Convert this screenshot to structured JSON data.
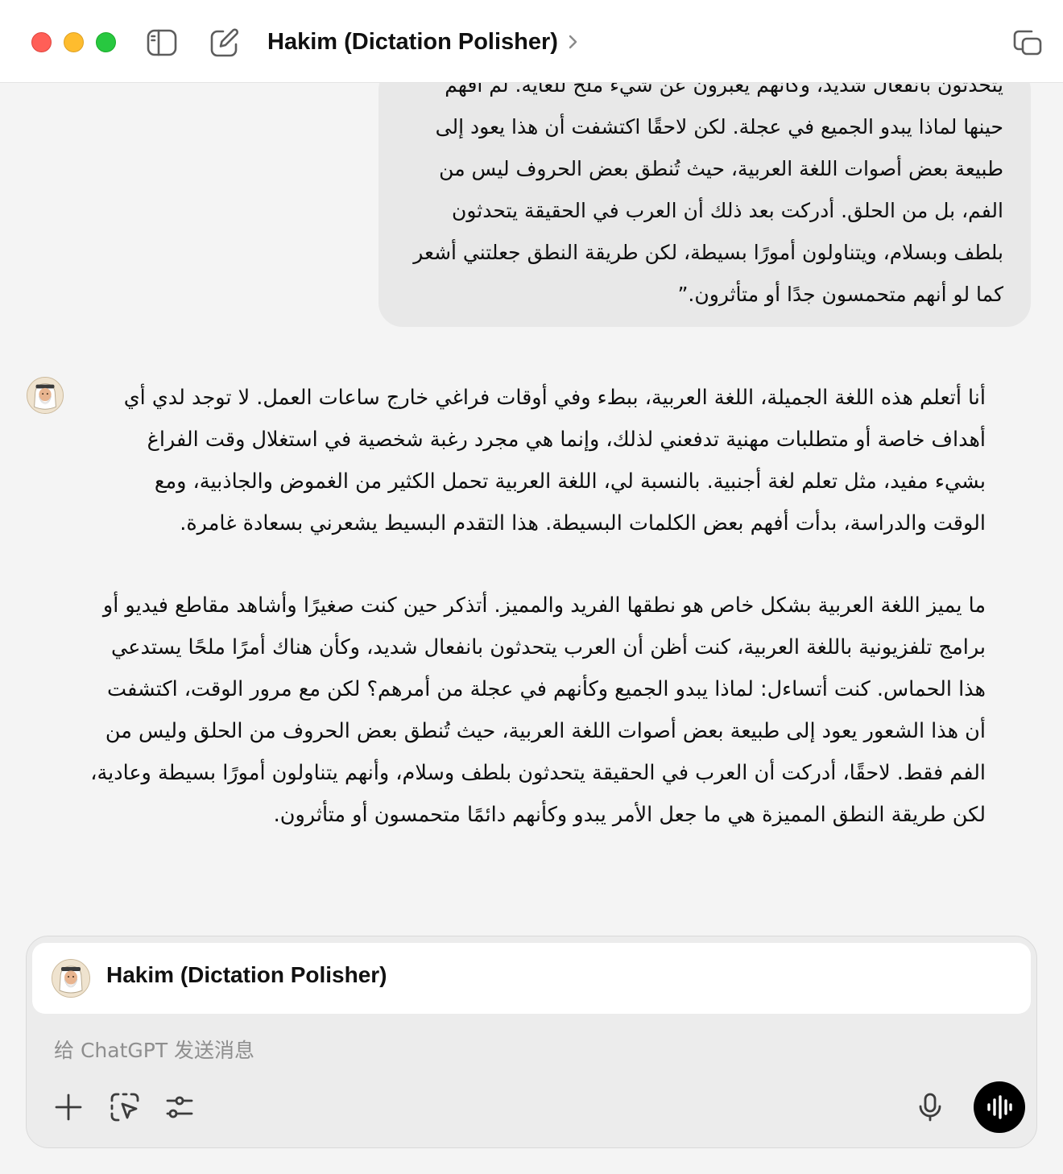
{
  "window": {
    "title": "Hakim (Dictation Polisher)"
  },
  "conversation": {
    "user_message_lines": [
      "يتحدثون بانفعال شديد، وكأنهم يعبرون عن شيء ملح للغاية. لم أفهم",
      "حينها لماذا يبدو الجميع في عجلة. لكن لاحقًا اكتشفت أن هذا يعود إلى",
      "طبيعة بعض أصوات اللغة العربية، حيث تُنطق بعض الحروف ليس من",
      "الفم، بل من الحلق. أدركت بعد ذلك أن العرب في الحقيقة يتحدثون",
      "بلطف وبسلام، ويتناولون أمورًا بسيطة، لكن طريقة النطق جعلتني أشعر",
      "كما لو أنهم متحمسون جدًا أو متأثرون.”"
    ],
    "assistant_paragraph_1": [
      "أنا أتعلم هذه اللغة الجميلة، اللغة العربية، ببطء وفي أوقات فراغي خارج ساعات العمل. لا توجد لدي أي",
      "أهداف خاصة أو متطلبات مهنية تدفعني لذلك، وإنما هي مجرد رغبة شخصية في استغلال وقت الفراغ",
      "بشيء مفيد، مثل تعلم لغة أجنبية. بالنسبة لي، اللغة العربية تحمل الكثير من الغموض والجاذبية، ومع",
      "الوقت والدراسة، بدأت أفهم بعض الكلمات البسيطة. هذا التقدم البسيط يشعرني بسعادة غامرة."
    ],
    "assistant_paragraph_2": [
      "ما يميز اللغة العربية بشكل خاص هو نطقها الفريد والمميز. أتذكر حين كنت صغيرًا وأشاهد مقاطع فيديو أو",
      "برامج تلفزيونية باللغة العربية، كنت أظن أن العرب يتحدثون بانفعال شديد، وكأن هناك أمرًا ملحًا يستدعي",
      "هذا الحماس. كنت أتساءل: لماذا يبدو الجميع وكأنهم في عجلة من أمرهم؟ لكن مع مرور الوقت، اكتشفت",
      "أن هذا الشعور يعود إلى طبيعة بعض أصوات اللغة العربية، حيث تُنطق بعض الحروف من الحلق وليس من",
      "الفم فقط. لاحقًا، أدركت أن العرب في الحقيقة يتحدثون بلطف وسلام، وأنهم يتناولون أمورًا بسيطة وعادية،",
      "لكن طريقة النطق المميزة هي ما جعل الأمر يبدو وكأنهم دائمًا متحمسون أو متأثرون."
    ]
  },
  "composer": {
    "gpt_name": "Hakim (Dictation Polisher)",
    "placeholder": "给 ChatGPT 发送消息",
    "value": ""
  },
  "icons": {
    "sidebar_toggle": "sidebar-toggle-icon",
    "new_chat": "compose-icon",
    "title_chevron": "chevron-right-icon",
    "new_window": "new-window-icon",
    "add": "plus-icon",
    "screen_select": "screen-capture-icon",
    "tools": "sliders-icon",
    "mic": "microphone-icon",
    "voice_mode": "voice-waveform-icon"
  },
  "colors": {
    "traffic_red": "#ff5f57",
    "traffic_yellow": "#febc2e",
    "traffic_green": "#28c840",
    "user_bubble": "#e8e8e8",
    "voice_button": "#000000"
  }
}
